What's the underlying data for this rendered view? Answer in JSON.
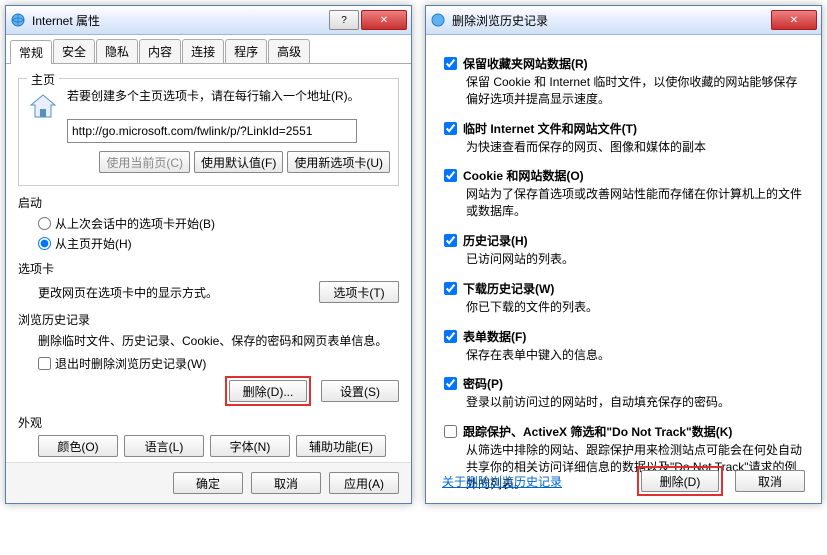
{
  "left": {
    "title": "Internet 属性",
    "tabs": [
      "常规",
      "安全",
      "隐私",
      "内容",
      "连接",
      "程序",
      "高级"
    ],
    "homepage": {
      "group": "主页",
      "hint": "若要创建多个主页选项卡，请在每行输入一个地址(R)。",
      "url": "http://go.microsoft.com/fwlink/p/?LinkId=2551",
      "btn_current": "使用当前页(C)",
      "btn_default": "使用默认值(F)",
      "btn_newtab": "使用新选项卡(U)"
    },
    "startup": {
      "group": "启动",
      "opt_last": "从上次会话中的选项卡开始(B)",
      "opt_home": "从主页开始(H)"
    },
    "tabs_section": {
      "group": "选项卡",
      "desc": "更改网页在选项卡中的显示方式。",
      "btn_tabs": "选项卡(T)"
    },
    "history": {
      "group": "浏览历史记录",
      "desc": "删除临时文件、历史记录、Cookie、保存的密码和网页表单信息。",
      "chk_exit": "退出时删除浏览历史记录(W)",
      "btn_delete": "删除(D)...",
      "btn_settings": "设置(S)"
    },
    "appearance": {
      "group": "外观",
      "btn_colors": "颜色(O)",
      "btn_lang": "语言(L)",
      "btn_fonts": "字体(N)",
      "btn_access": "辅助功能(E)"
    },
    "bottom": {
      "ok": "确定",
      "cancel": "取消",
      "apply": "应用(A)"
    }
  },
  "right": {
    "title": "删除浏览历史记录",
    "items": [
      {
        "checked": true,
        "label": "保留收藏夹网站数据(R)",
        "desc": "保留 Cookie 和 Internet 临时文件，以使你收藏的网站能够保存偏好选项并提高显示速度。"
      },
      {
        "checked": true,
        "label": "临时 Internet 文件和网站文件(T)",
        "desc": "为快速查看而保存的网页、图像和媒体的副本"
      },
      {
        "checked": true,
        "label": "Cookie 和网站数据(O)",
        "desc": "网站为了保存首选项或改善网站性能而存储在你计算机上的文件或数据库。"
      },
      {
        "checked": true,
        "label": "历史记录(H)",
        "desc": "已访问网站的列表。"
      },
      {
        "checked": true,
        "label": "下载历史记录(W)",
        "desc": "你已下载的文件的列表。"
      },
      {
        "checked": true,
        "label": "表单数据(F)",
        "desc": "保存在表单中键入的信息。"
      },
      {
        "checked": true,
        "label": "密码(P)",
        "desc": "登录以前访问过的网站时，自动填充保存的密码。"
      },
      {
        "checked": false,
        "label": "跟踪保护、ActiveX 筛选和\"Do Not Track\"数据(K)",
        "desc": "从筛选中排除的网站、跟踪保护用来检测站点可能会在何处自动共享你的相关访问详细信息的数据以及\"Do Not Track\"请求的例外的列表。"
      }
    ],
    "link": "关于删除浏览历史记录",
    "btn_delete": "删除(D)",
    "btn_cancel": "取消"
  }
}
